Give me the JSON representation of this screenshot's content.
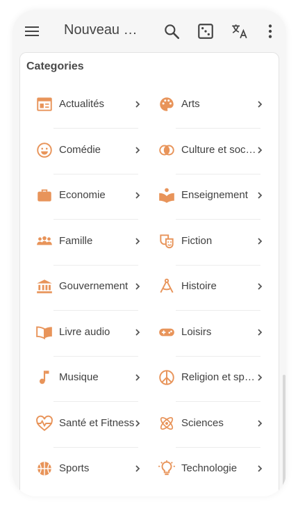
{
  "appbar": {
    "title": "Nouveau Podcasts",
    "actions": [
      "search-icon",
      "dice-icon",
      "translate-icon",
      "more-vert-icon"
    ]
  },
  "section": {
    "title": "Categories"
  },
  "colors": {
    "accent": "#e8945a",
    "text": "#404040",
    "chevron": "#555555"
  },
  "categories": [
    {
      "label": "Actualités",
      "icon": "newspaper-icon"
    },
    {
      "label": "Arts",
      "icon": "palette-icon"
    },
    {
      "label": "Comédie",
      "icon": "smiley-icon"
    },
    {
      "label": "Culture et société",
      "icon": "circles-icon"
    },
    {
      "label": "Economie",
      "icon": "briefcase-icon"
    },
    {
      "label": "Enseignement",
      "icon": "reading-icon"
    },
    {
      "label": "Famille",
      "icon": "family-icon"
    },
    {
      "label": "Fiction",
      "icon": "masks-icon"
    },
    {
      "label": "Gouvernement",
      "icon": "bank-icon"
    },
    {
      "label": "Histoire",
      "icon": "compass-icon"
    },
    {
      "label": "Livre audio",
      "icon": "book-icon"
    },
    {
      "label": "Loisirs",
      "icon": "gamepad-icon"
    },
    {
      "label": "Musique",
      "icon": "music-note-icon"
    },
    {
      "label": "Religion et spiritualité",
      "icon": "peace-icon"
    },
    {
      "label": "Santé et Fitness",
      "icon": "heartbeat-icon"
    },
    {
      "label": "Sciences",
      "icon": "atom-icon"
    },
    {
      "label": "Sports",
      "icon": "basketball-icon"
    },
    {
      "label": "Technologie",
      "icon": "lightbulb-icon"
    }
  ]
}
